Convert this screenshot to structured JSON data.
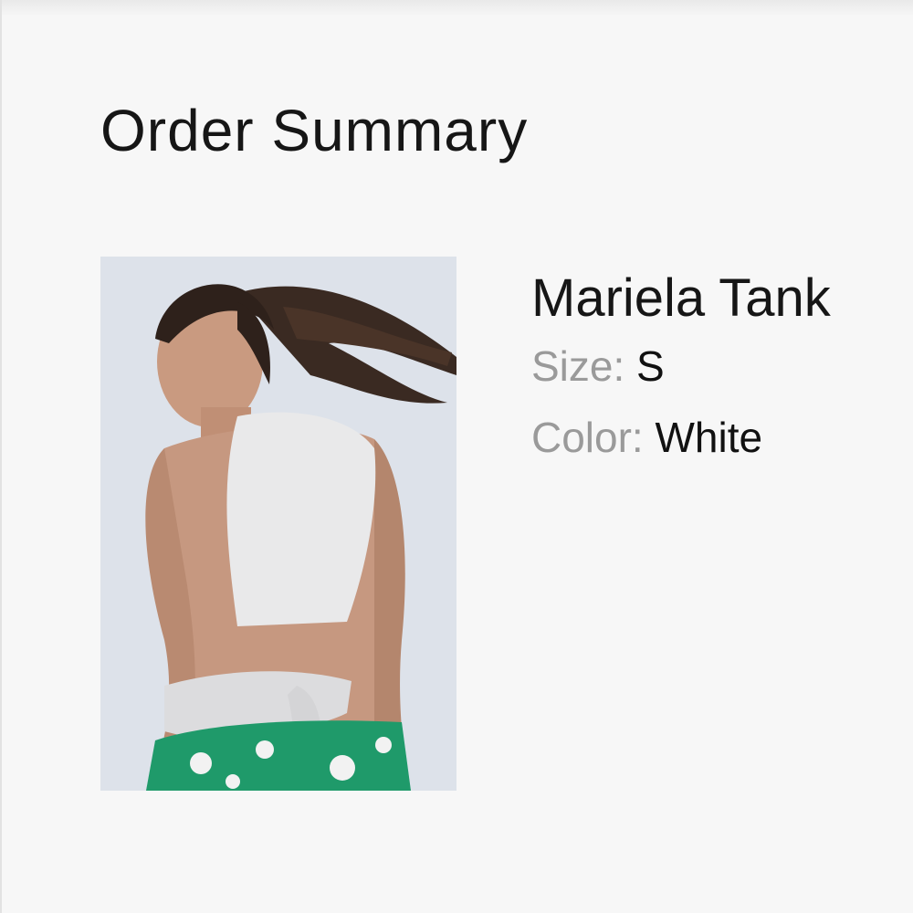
{
  "order_summary": {
    "title": "Order Summary",
    "item": {
      "name": "Mariela Tank",
      "size_label": "Size:",
      "size_value": "S",
      "color_label": "Color:",
      "color_value": "White"
    }
  },
  "colors": {
    "background": "#f7f7f7",
    "text": "#161616",
    "label_gray": "#9a9a9a"
  }
}
